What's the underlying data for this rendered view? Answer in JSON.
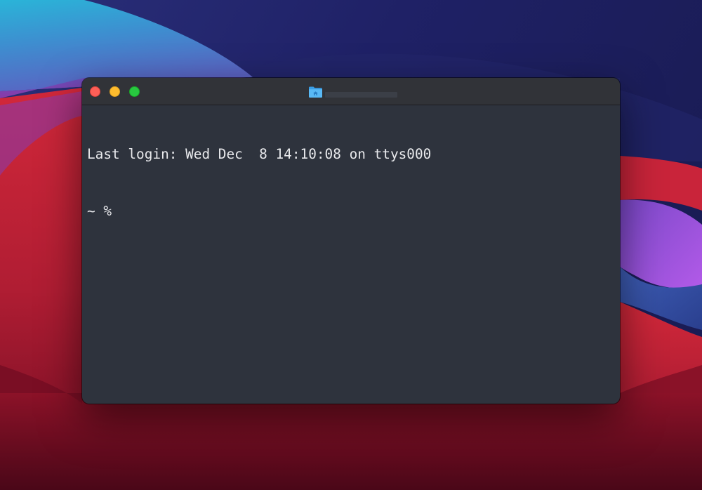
{
  "desktop": {
    "wallpaper": "macOS Big Sur",
    "colors": {
      "navy": "#1f205e",
      "cyan": "#39a4d6",
      "red": "#c22336",
      "purple": "#a94fe0",
      "crimson": "#7b0f26"
    }
  },
  "window": {
    "app": "Terminal",
    "title_icon": "home-folder-icon",
    "title": "",
    "controls": {
      "close": "close",
      "minimize": "minimize",
      "zoom": "zoom"
    },
    "background_color": "#2e333d",
    "text_color": "#e8e9ec"
  },
  "terminal": {
    "last_login": "Last login: Wed Dec  8 14:10:08 on ttys000",
    "prompt": "~ %"
  }
}
